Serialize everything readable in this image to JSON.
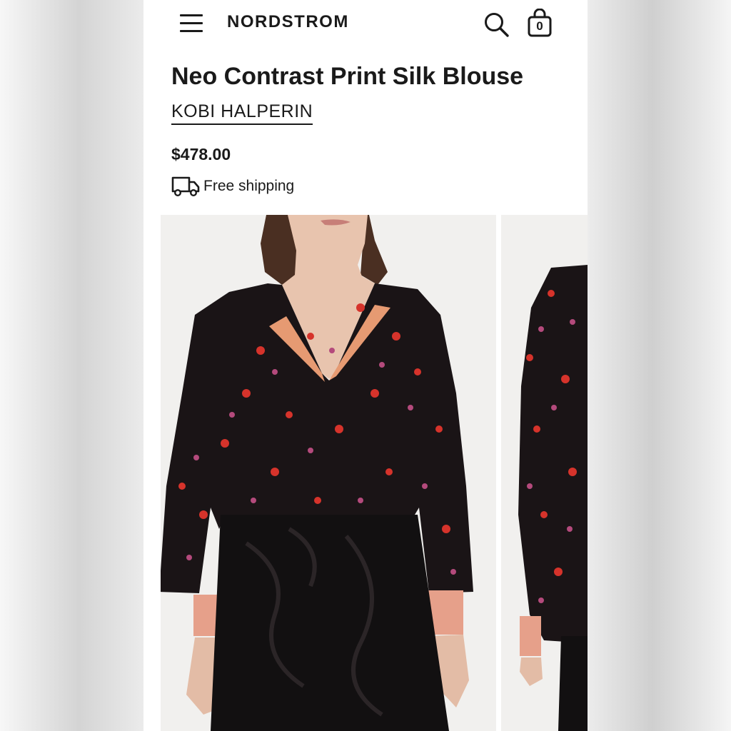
{
  "header": {
    "brand": "NORDSTROM",
    "bag_count": "0",
    "icons": [
      "menu-icon",
      "search-icon",
      "shopping-bag-icon"
    ]
  },
  "product": {
    "title": "Neo Contrast Print Silk Blouse",
    "designer": "KOBI HALPERIN",
    "price": "$478.00",
    "shipping": "Free shipping"
  },
  "gallery": {
    "images": [
      "model-front-view",
      "model-side-view"
    ]
  },
  "colors": {
    "text": "#1a1a1a",
    "background": "#ffffff",
    "photo_background": "#f1f0ee",
    "blouse": "#1a1416",
    "print_red": "#d6332b",
    "print_pink": "#b44a7c",
    "trim": "#e69a72"
  }
}
